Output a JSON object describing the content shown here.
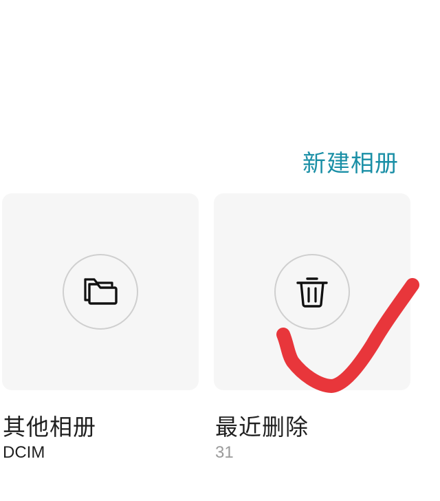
{
  "header": {
    "new_album_label": "新建相册"
  },
  "albums": [
    {
      "title": "其他相册",
      "subtitle": "DCIM",
      "icon": "folder-icon"
    },
    {
      "title": "最近删除",
      "subtitle": "31",
      "icon": "trash-icon"
    }
  ],
  "annotation": {
    "shape": "checkmark",
    "color": "#e8363b"
  }
}
